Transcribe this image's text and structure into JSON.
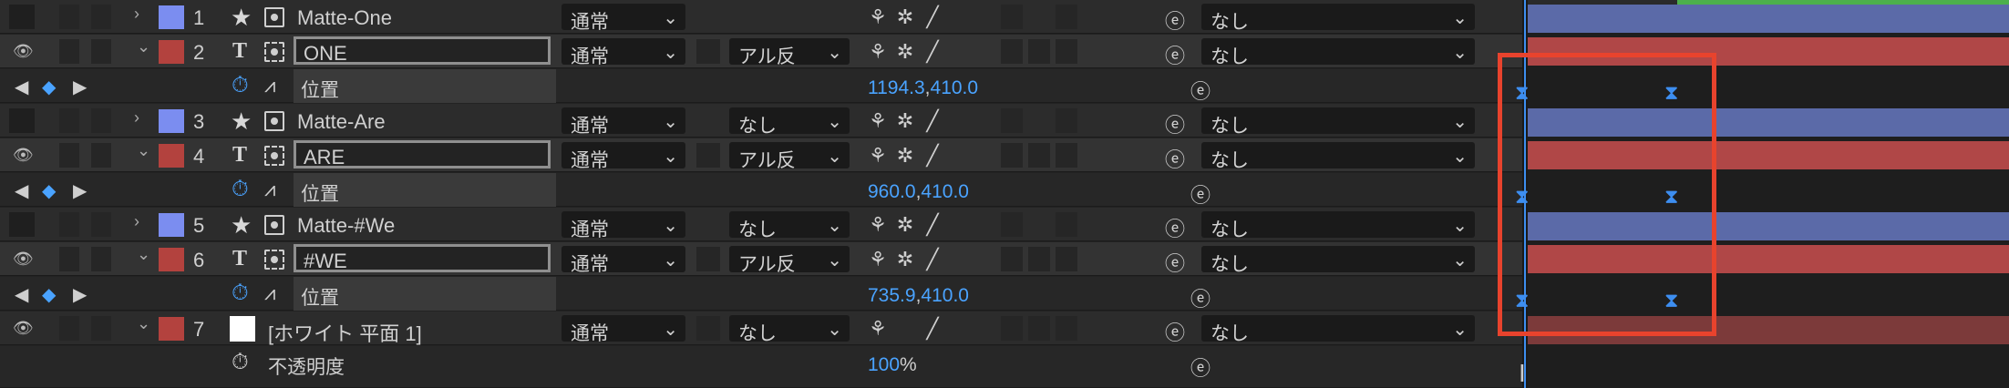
{
  "layers": [
    {
      "num": "1",
      "name": "Matte-One",
      "color": "#7b8df0",
      "kind": "star",
      "mode": "通常",
      "trkmat": "",
      "parent": "なし",
      "eye": false,
      "highlight": false
    },
    {
      "num": "2",
      "name": "ONE",
      "color": "#b3423e",
      "kind": "text",
      "mode": "通常",
      "trkmat": "アル反",
      "parent": "なし",
      "eye": true,
      "highlight": true
    },
    {
      "num": "3",
      "name": "Matte-Are",
      "color": "#7b8df0",
      "kind": "star",
      "mode": "通常",
      "trkmat": "なし",
      "parent": "なし",
      "eye": false,
      "highlight": false
    },
    {
      "num": "4",
      "name": "ARE",
      "color": "#b3423e",
      "kind": "text",
      "mode": "通常",
      "trkmat": "アル反",
      "parent": "なし",
      "eye": true,
      "highlight": true
    },
    {
      "num": "5",
      "name": "Matte-#We",
      "color": "#7b8df0",
      "kind": "star",
      "mode": "通常",
      "trkmat": "なし",
      "parent": "なし",
      "eye": false,
      "highlight": false
    },
    {
      "num": "6",
      "name": "#WE",
      "color": "#b3423e",
      "kind": "text",
      "mode": "通常",
      "trkmat": "アル反",
      "parent": "なし",
      "eye": true,
      "highlight": true
    },
    {
      "num": "7",
      "name": "[ホワイト 平面 1]",
      "color": "#b3423e",
      "kind": "solid",
      "mode": "通常",
      "trkmat": "なし",
      "parent": "なし",
      "eye": true,
      "highlight": false
    }
  ],
  "properties": {
    "position_label": "位置",
    "opacity_label": "不透明度",
    "pos_one": {
      "x": "1194.3",
      "comma": ",",
      "y": "410.0"
    },
    "pos_are": {
      "x": "960.0",
      "comma": ",",
      "y": "410.0"
    },
    "pos_we": {
      "x": "735.9",
      "comma": ",",
      "y": "410.0"
    },
    "opacity": {
      "value": "100",
      "unit": "%"
    }
  },
  "icons": {
    "eye": "eye-icon",
    "expand": "chevron-icon",
    "star": "star-icon",
    "text": "text-layer-icon",
    "stopwatch": "stopwatch-icon",
    "graph": "graph-icon",
    "spiral": "spiral-icon",
    "keyframe": "keyframe-icon",
    "shy": "shy-icon",
    "quality": "quality-icon"
  },
  "colors": {
    "accent": "#4aa3ff",
    "highlight": "#e8432d",
    "blue_label": "#7b8df0",
    "red_label": "#b3423e"
  }
}
